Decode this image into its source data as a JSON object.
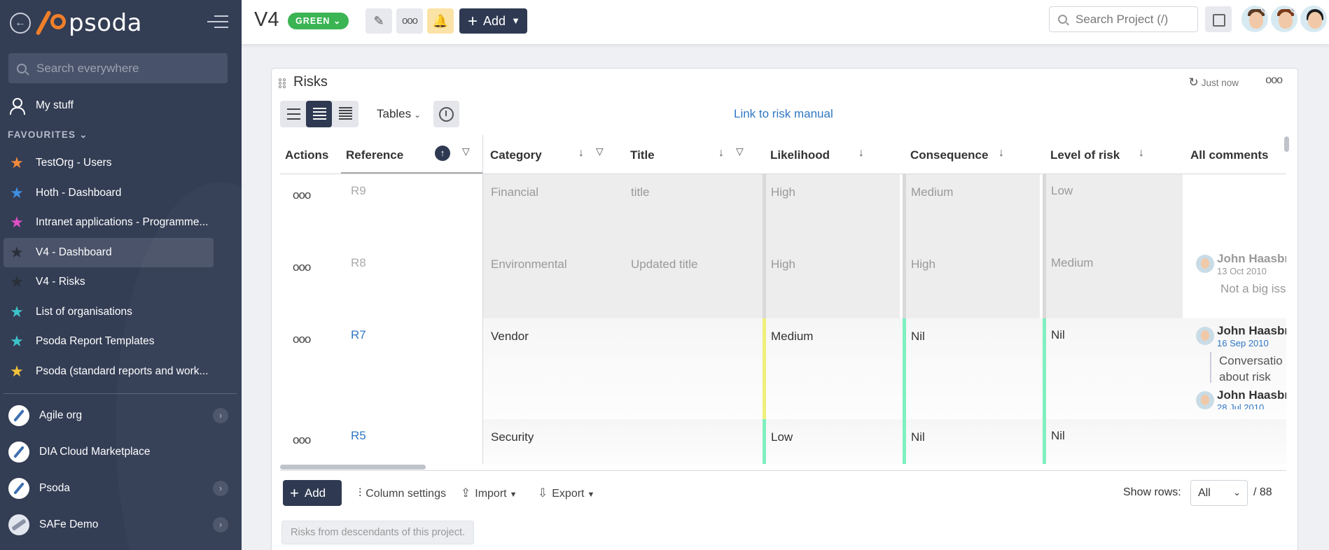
{
  "sidebar": {
    "logo_text": "psoda",
    "search_placeholder": "Search everywhere",
    "my_stuff": "My stuff",
    "favourites_heading": "FAVOURITES",
    "favourites": [
      {
        "label": "TestOrg - Users",
        "star_color": "#f08a3a"
      },
      {
        "label": "Hoth - Dashboard",
        "star_color": "#3f8fe0"
      },
      {
        "label": "Intranet applications - Programme...",
        "star_color": "#e04fc4"
      },
      {
        "label": "V4 - Dashboard",
        "star_color": "#2a2f3a"
      },
      {
        "label": "V4 - Risks",
        "star_color": "#2a2f3a"
      },
      {
        "label": "List of organisations",
        "star_color": "#3cc4c9"
      },
      {
        "label": "Psoda Report Templates",
        "star_color": "#3cc4c9"
      },
      {
        "label": "Psoda (standard reports and work...",
        "star_color": "#f2c23a"
      }
    ],
    "orgs": [
      {
        "label": "Agile org",
        "has_chevron": true
      },
      {
        "label": "DIA Cloud Marketplace",
        "has_chevron": false
      },
      {
        "label": "Psoda",
        "has_chevron": true
      },
      {
        "label": "SAFe Demo",
        "has_chevron": true
      }
    ]
  },
  "topbar": {
    "project": "V4",
    "status": "GREEN",
    "add_label": "Add",
    "search_placeholder": "Search Project (/)"
  },
  "risks": {
    "title": "Risks",
    "refreshed": "Just now",
    "tables_label": "Tables",
    "manual_link": "Link to risk manual",
    "columns": [
      "Actions",
      "Reference",
      "Category",
      "Title",
      "Likelihood",
      "Consequence",
      "Level of risk",
      "All comments"
    ],
    "rows": [
      {
        "ref": "R9",
        "category": "Financial",
        "title": "title",
        "likelihood": "High",
        "consequence": "Medium",
        "level": "Low",
        "greyed": true,
        "comments": []
      },
      {
        "ref": "R8",
        "category": "Environmental",
        "title": "Updated title",
        "likelihood": "High",
        "consequence": "High",
        "level": "Medium",
        "greyed": true,
        "comments": [
          {
            "name": "John Haasbr",
            "date": "13 Oct 2010",
            "text": "Not a big iss"
          }
        ]
      },
      {
        "ref": "R7",
        "category": "Vendor",
        "title": "",
        "likelihood": "Medium",
        "consequence": "Nil",
        "level": "Nil",
        "greyed": false,
        "likelihood_color": "#f0ef7a",
        "consequence_color": "#7ff0c0",
        "level_color": "#7ff0c0",
        "comments": [
          {
            "name": "John Haasbr",
            "date": "16 Sep 2010",
            "text_lines": [
              "Conversatio",
              "about risk"
            ]
          },
          {
            "name": "John Haasbr",
            "date": "28 Jul 2010"
          }
        ]
      },
      {
        "ref": "R5",
        "category": "Security",
        "title": "",
        "likelihood": "Low",
        "consequence": "Nil",
        "level": "Nil",
        "greyed": false,
        "likelihood_color": "#7ff0c0",
        "consequence_color": "#7ff0c0",
        "level_color": "#7ff0c0",
        "comments": []
      }
    ],
    "footer": {
      "add_label": "Add",
      "column_settings": "Column settings",
      "import_label": "Import",
      "export_label": "Export",
      "show_rows_label": "Show rows:",
      "show_rows_value": "All",
      "total": "/ 88",
      "descendants_note": "Risks from descendants of this project."
    }
  }
}
